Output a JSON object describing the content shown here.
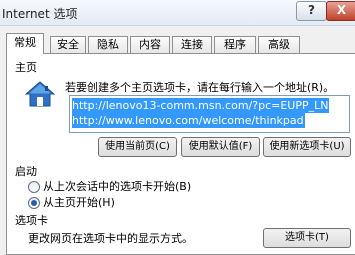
{
  "window": {
    "title": "Internet 选项",
    "help_label": "?",
    "close_label": "X"
  },
  "tabs": [
    {
      "label": "常规",
      "active": true
    },
    {
      "label": "安全",
      "active": false
    },
    {
      "label": "隐私",
      "active": false
    },
    {
      "label": "内容",
      "active": false
    },
    {
      "label": "连接",
      "active": false
    },
    {
      "label": "程序",
      "active": false
    },
    {
      "label": "高级",
      "active": false
    }
  ],
  "home_page": {
    "section_title": "主页",
    "icon": "house-icon",
    "hint": "若要创建多个主页选项卡，请在每行输入一个地址(R)。",
    "urls": [
      "http://lenovo13-comm.msn.com/?pc=EUPP_LN",
      "http://www.lenovo.com/welcome/thinkpad"
    ],
    "buttons": {
      "use_current": "使用当前页(C)",
      "use_default": "使用默认值(F)",
      "use_new_tab": "使用新选项卡(U)"
    }
  },
  "startup": {
    "section_title": "启动",
    "options": [
      {
        "label": "从上次会话中的选项卡开始(B)",
        "selected": false
      },
      {
        "label": "从主页开始(H)",
        "selected": true
      }
    ]
  },
  "tabs_section": {
    "section_title": "选项卡",
    "description": "更改网页在选项卡中的显示方式。",
    "button": "选项卡(T)"
  }
}
